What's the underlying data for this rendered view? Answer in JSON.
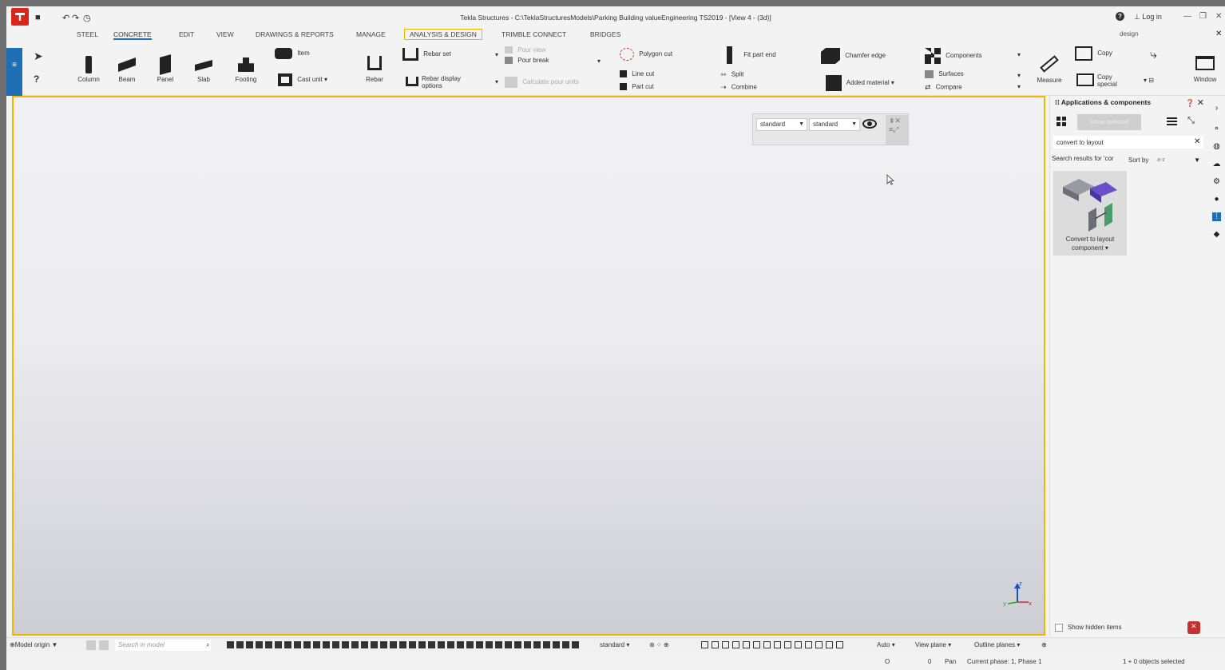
{
  "window": {
    "title": "Tekla Structures - C:\\TeklaStructuresModels\\Parking Building valueEngineering TS2019 - [View 4 - (3d)]",
    "login": "Log in",
    "design_field": "design"
  },
  "menu": {
    "tabs": [
      "STEEL",
      "CONCRETE",
      "EDIT",
      "VIEW",
      "DRAWINGS & REPORTS",
      "MANAGE",
      "ANALYSIS & DESIGN",
      "TRIMBLE CONNECT",
      "BRIDGES"
    ]
  },
  "ribbon": {
    "column": "Column",
    "beam": "Beam",
    "panel": "Panel",
    "slab": "Slab",
    "footing": "Footing",
    "item": "Item",
    "cast_unit": "Cast unit",
    "rebar": "Rebar",
    "rebar_set": "Rebar set",
    "rebar_display_options": "Rebar display options",
    "pour_view": "Pour view",
    "pour_break": "Pour break",
    "calculate_pour_units": "Calculate pour units",
    "polygon_cut": "Polygon cut",
    "line_cut": "Line cut",
    "part_cut": "Part cut",
    "fit_part_end": "Fit part end",
    "split": "Split",
    "combine": "Combine",
    "chamfer_edge": "Chamfer edge",
    "added_material": "Added material",
    "components": "Components",
    "surfaces": "Surfaces",
    "compare": "Compare",
    "measure": "Measure",
    "copy": "Copy",
    "copy_special": "Copy special",
    "window": "Window"
  },
  "viewport": {
    "filter_1": "standard",
    "filter_2": "standard"
  },
  "panel": {
    "title": "Applications & components",
    "show_selected": "Show selected",
    "search_value": "convert to layout",
    "results_label": "Search results for 'cor",
    "sort_by": "Sort by",
    "sort_value": "a-z",
    "card_label": "Convert to layout component",
    "show_hidden": "Show hidden items"
  },
  "statusbar": {
    "model_origin": "Model origin",
    "search_placeholder": "Search in model",
    "standard": "standard",
    "auto": "Auto",
    "view_plane": "View plane",
    "outline_planes": "Outline planes"
  },
  "bottombar": {
    "o_label": "O",
    "zero": "0",
    "pan": "Pan",
    "current_phase": "Current phase: 1, Phase 1",
    "selection": "1 + 0 objects selected"
  },
  "colors": {
    "accent_blue": "#1f6fb5",
    "highlight_yellow": "#f2b800",
    "logo_red": "#d9261c"
  }
}
